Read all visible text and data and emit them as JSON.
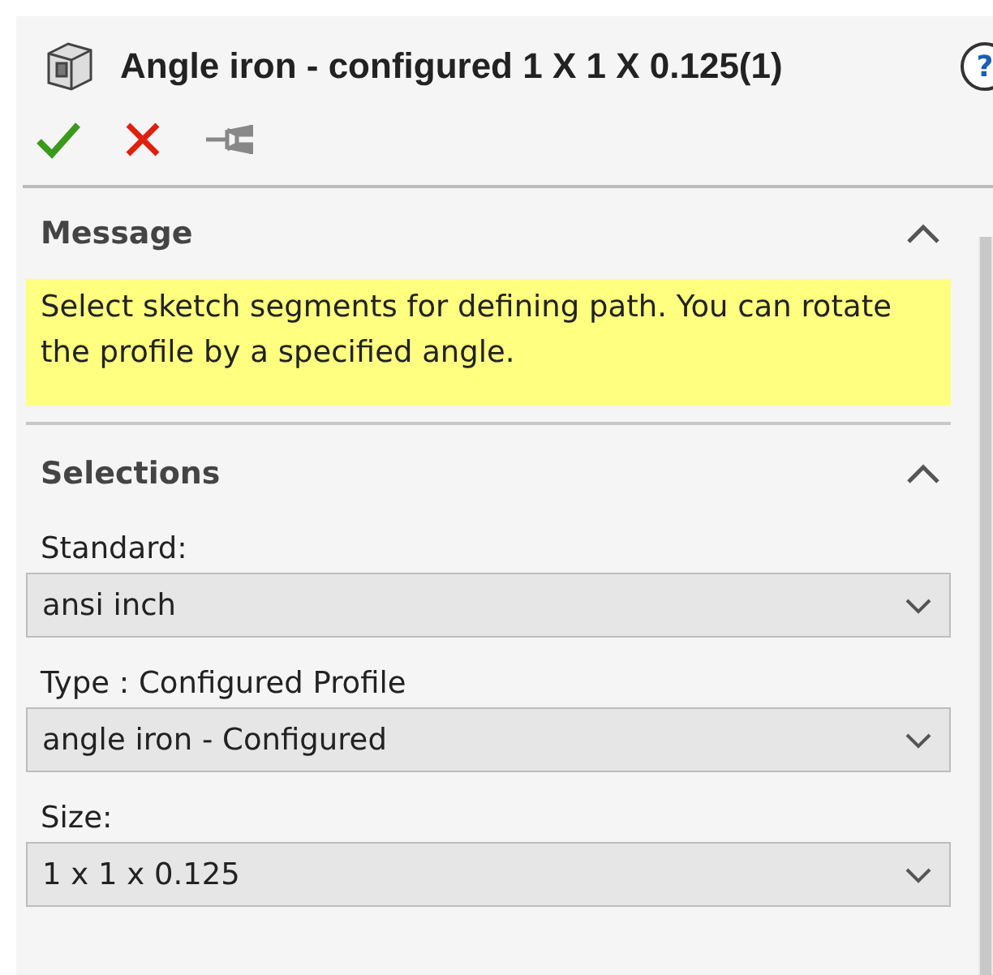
{
  "header": {
    "title": "Angle iron - configured 1 X 1 X 0.125(1)",
    "help": "?"
  },
  "toolbar": [
    {
      "kind": "ok"
    },
    {
      "kind": "cancel"
    },
    {
      "kind": "pin"
    }
  ],
  "sections": [
    {
      "kind": "message",
      "title": "Message",
      "expanded": true,
      "text": "Select sketch segments for defining path. You can rotate the profile by a specified angle."
    },
    {
      "kind": "fields",
      "title": "Selections",
      "expanded": true,
      "fields": [
        {
          "label": "Standard:",
          "value": "ansi inch"
        },
        {
          "label": "Type : Configured Profile",
          "value": "angle iron - Configured"
        },
        {
          "label": "Size:",
          "value": "1 x 1 x 0.125"
        }
      ]
    }
  ]
}
